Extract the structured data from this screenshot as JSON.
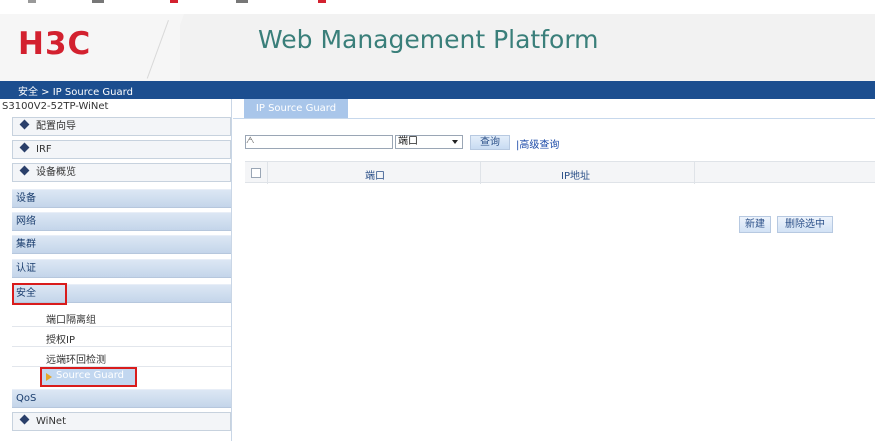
{
  "header": {
    "logo": "H3C",
    "title": "Web Management Platform"
  },
  "breadcrumb": "安全 > IP Source Guard",
  "sidebar": {
    "device_name": "S3100V2-52TP-WiNet",
    "items": [
      {
        "label": "配置向导",
        "type": "item"
      },
      {
        "label": "IRF",
        "type": "item"
      },
      {
        "label": "设备概览",
        "type": "item"
      },
      {
        "label": "设备",
        "type": "category"
      },
      {
        "label": "网络",
        "type": "category"
      },
      {
        "label": "集群",
        "type": "category"
      },
      {
        "label": "认证",
        "type": "category"
      },
      {
        "label": "安全",
        "type": "category"
      },
      {
        "label": "QoS",
        "type": "category"
      },
      {
        "label": "WiNet",
        "type": "item"
      }
    ],
    "security_subitems": [
      "端口隔离组",
      "授权IP",
      "远端环回检测",
      "Source Guard"
    ]
  },
  "main": {
    "tab_label": "IP Source Guard",
    "search": {
      "placeholder": ""
    },
    "select_value": "端口",
    "query_button": "查询",
    "advanced_query": "|高级查询",
    "columns": [
      "端口",
      "IP地址"
    ],
    "new_button": "新建",
    "delete_button": "删除选中"
  },
  "colors": {
    "brand_red": "#d3212f",
    "title_teal": "#3a7f7a",
    "nav_blue": "#1c4e8f",
    "highlight_red": "#d91c1c"
  }
}
